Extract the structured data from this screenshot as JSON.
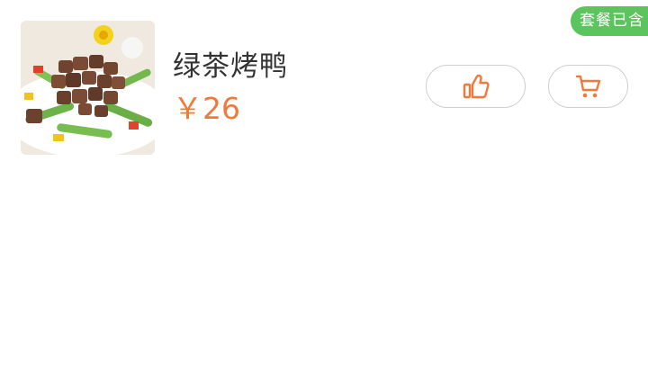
{
  "dish": {
    "name": "绿茶烤鸭",
    "price": "￥26",
    "image_icon": "dish-photo",
    "badge": "套餐已含"
  },
  "actions": {
    "like_icon": "thumbs-up-icon",
    "cart_icon": "shopping-cart-icon"
  },
  "colors": {
    "accent": "#f07a3c",
    "badge_green": "#5cc45d",
    "border": "#cfcfcf",
    "text": "#333333"
  }
}
